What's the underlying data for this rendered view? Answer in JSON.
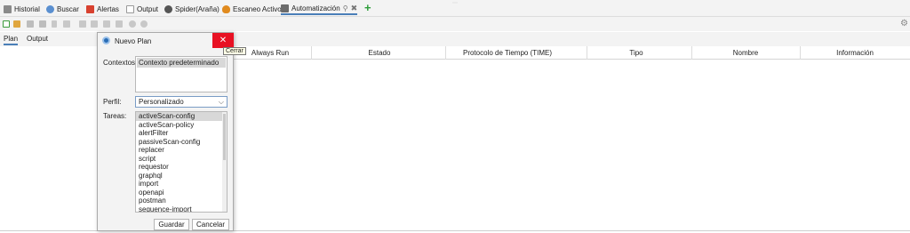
{
  "top_tabs": [
    {
      "label": "Historial",
      "icon": "history-icon",
      "color": "#7a7a7a"
    },
    {
      "label": "Buscar",
      "icon": "search-icon",
      "color": "#5a8fd0"
    },
    {
      "label": "Alertas",
      "icon": "flag-icon",
      "color": "#d8412f"
    },
    {
      "label": "Output",
      "icon": "output-icon",
      "color": "#9a9a9a"
    },
    {
      "label": "Spider(Araña)",
      "icon": "spider-icon",
      "color": "#555555"
    },
    {
      "label": "Escaneo Activo",
      "icon": "fire-icon",
      "color": "#e08a1e"
    },
    {
      "label": "Automatización",
      "icon": "robot-icon",
      "color": "#6b6b6b"
    }
  ],
  "subtabs": [
    "Plan",
    "Output"
  ],
  "table_headers": [
    "Always Run",
    "Estado",
    "Protocolo de Tiempo (TIME)",
    "Tipo",
    "Nombre",
    "Información"
  ],
  "dialog": {
    "title": "Nuevo Plan",
    "close_tooltip": "Cerrar",
    "contexts_label": "Contextos:",
    "contexts": [
      "Contexto predeterminado"
    ],
    "profile_label": "Perfil:",
    "profile_value": "Personalizado",
    "tasks_label": "Tareas:",
    "tasks": [
      "activeScan-config",
      "activeScan-policy",
      "alertFilter",
      "passiveScan-config",
      "replacer",
      "script",
      "requestor",
      "graphql",
      "import",
      "openapi",
      "postman",
      "sequence-import"
    ],
    "save_label": "Guardar",
    "cancel_label": "Cancelar"
  },
  "colors": {
    "accent": "#4a7fb8",
    "close": "#e81123",
    "add": "#2e9e3a"
  }
}
